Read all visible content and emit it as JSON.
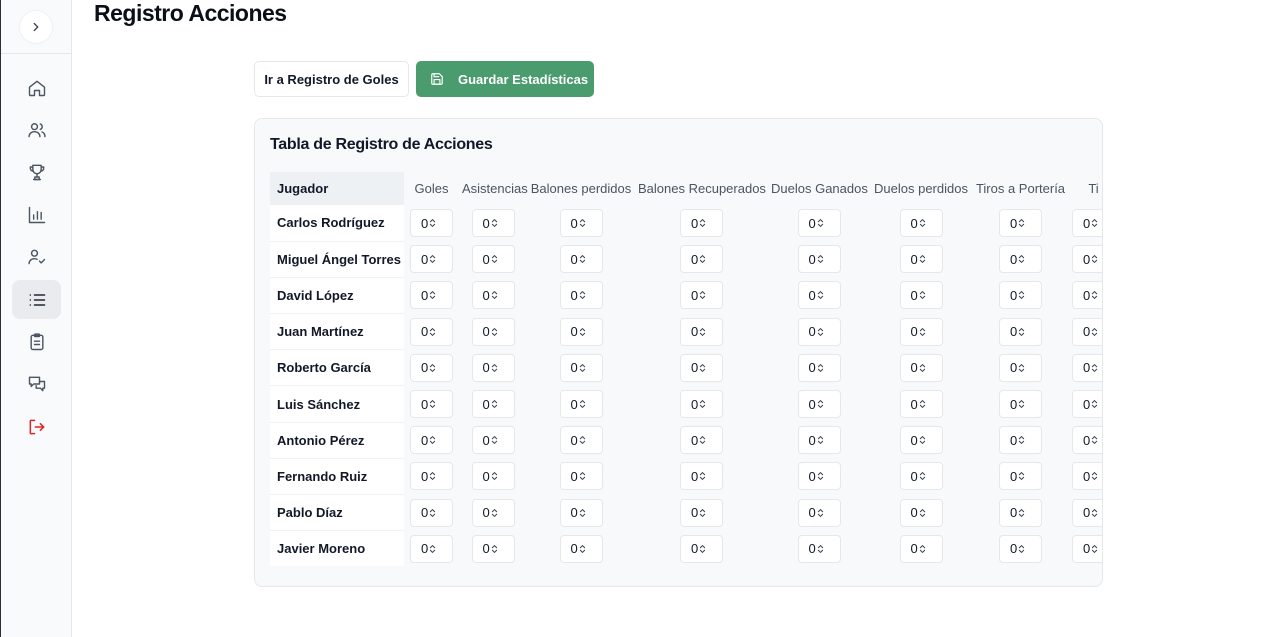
{
  "page": {
    "title": "Registro Acciones"
  },
  "sidebar": {
    "toggle_icon": "chevron-right-icon",
    "items": [
      {
        "icon": "home-icon",
        "active": false
      },
      {
        "icon": "users-icon",
        "active": false
      },
      {
        "icon": "trophy-icon",
        "active": false
      },
      {
        "icon": "bar-chart-icon",
        "active": false
      },
      {
        "icon": "user-check-icon",
        "active": false
      },
      {
        "icon": "list-icon",
        "active": true
      },
      {
        "icon": "clipboard-icon",
        "active": false
      },
      {
        "icon": "messages-icon",
        "active": false
      },
      {
        "icon": "logout-icon",
        "active": false,
        "color": "#dc2626"
      }
    ]
  },
  "toolbar": {
    "goals_link_label": "Ir a Registro de Goles",
    "save_label": "Guardar Estadísticas",
    "save_color": "#4a9b6e"
  },
  "table": {
    "title": "Tabla de Registro de Acciones",
    "player_header": "Jugador",
    "columns": [
      "Goles",
      "Asistencias",
      "Balones perdidos",
      "Balones Recuperados",
      "Duelos Ganados",
      "Duelos perdidos",
      "Tiros a Portería",
      "Ti"
    ],
    "players": [
      "Carlos Rodríguez",
      "Miguel Ángel Torres",
      "David López",
      "Juan Martínez",
      "Roberto García",
      "Luis Sánchez",
      "Antonio Pérez",
      "Fernando Ruiz",
      "Pablo Díaz",
      "Javier Moreno"
    ],
    "value": "0"
  }
}
